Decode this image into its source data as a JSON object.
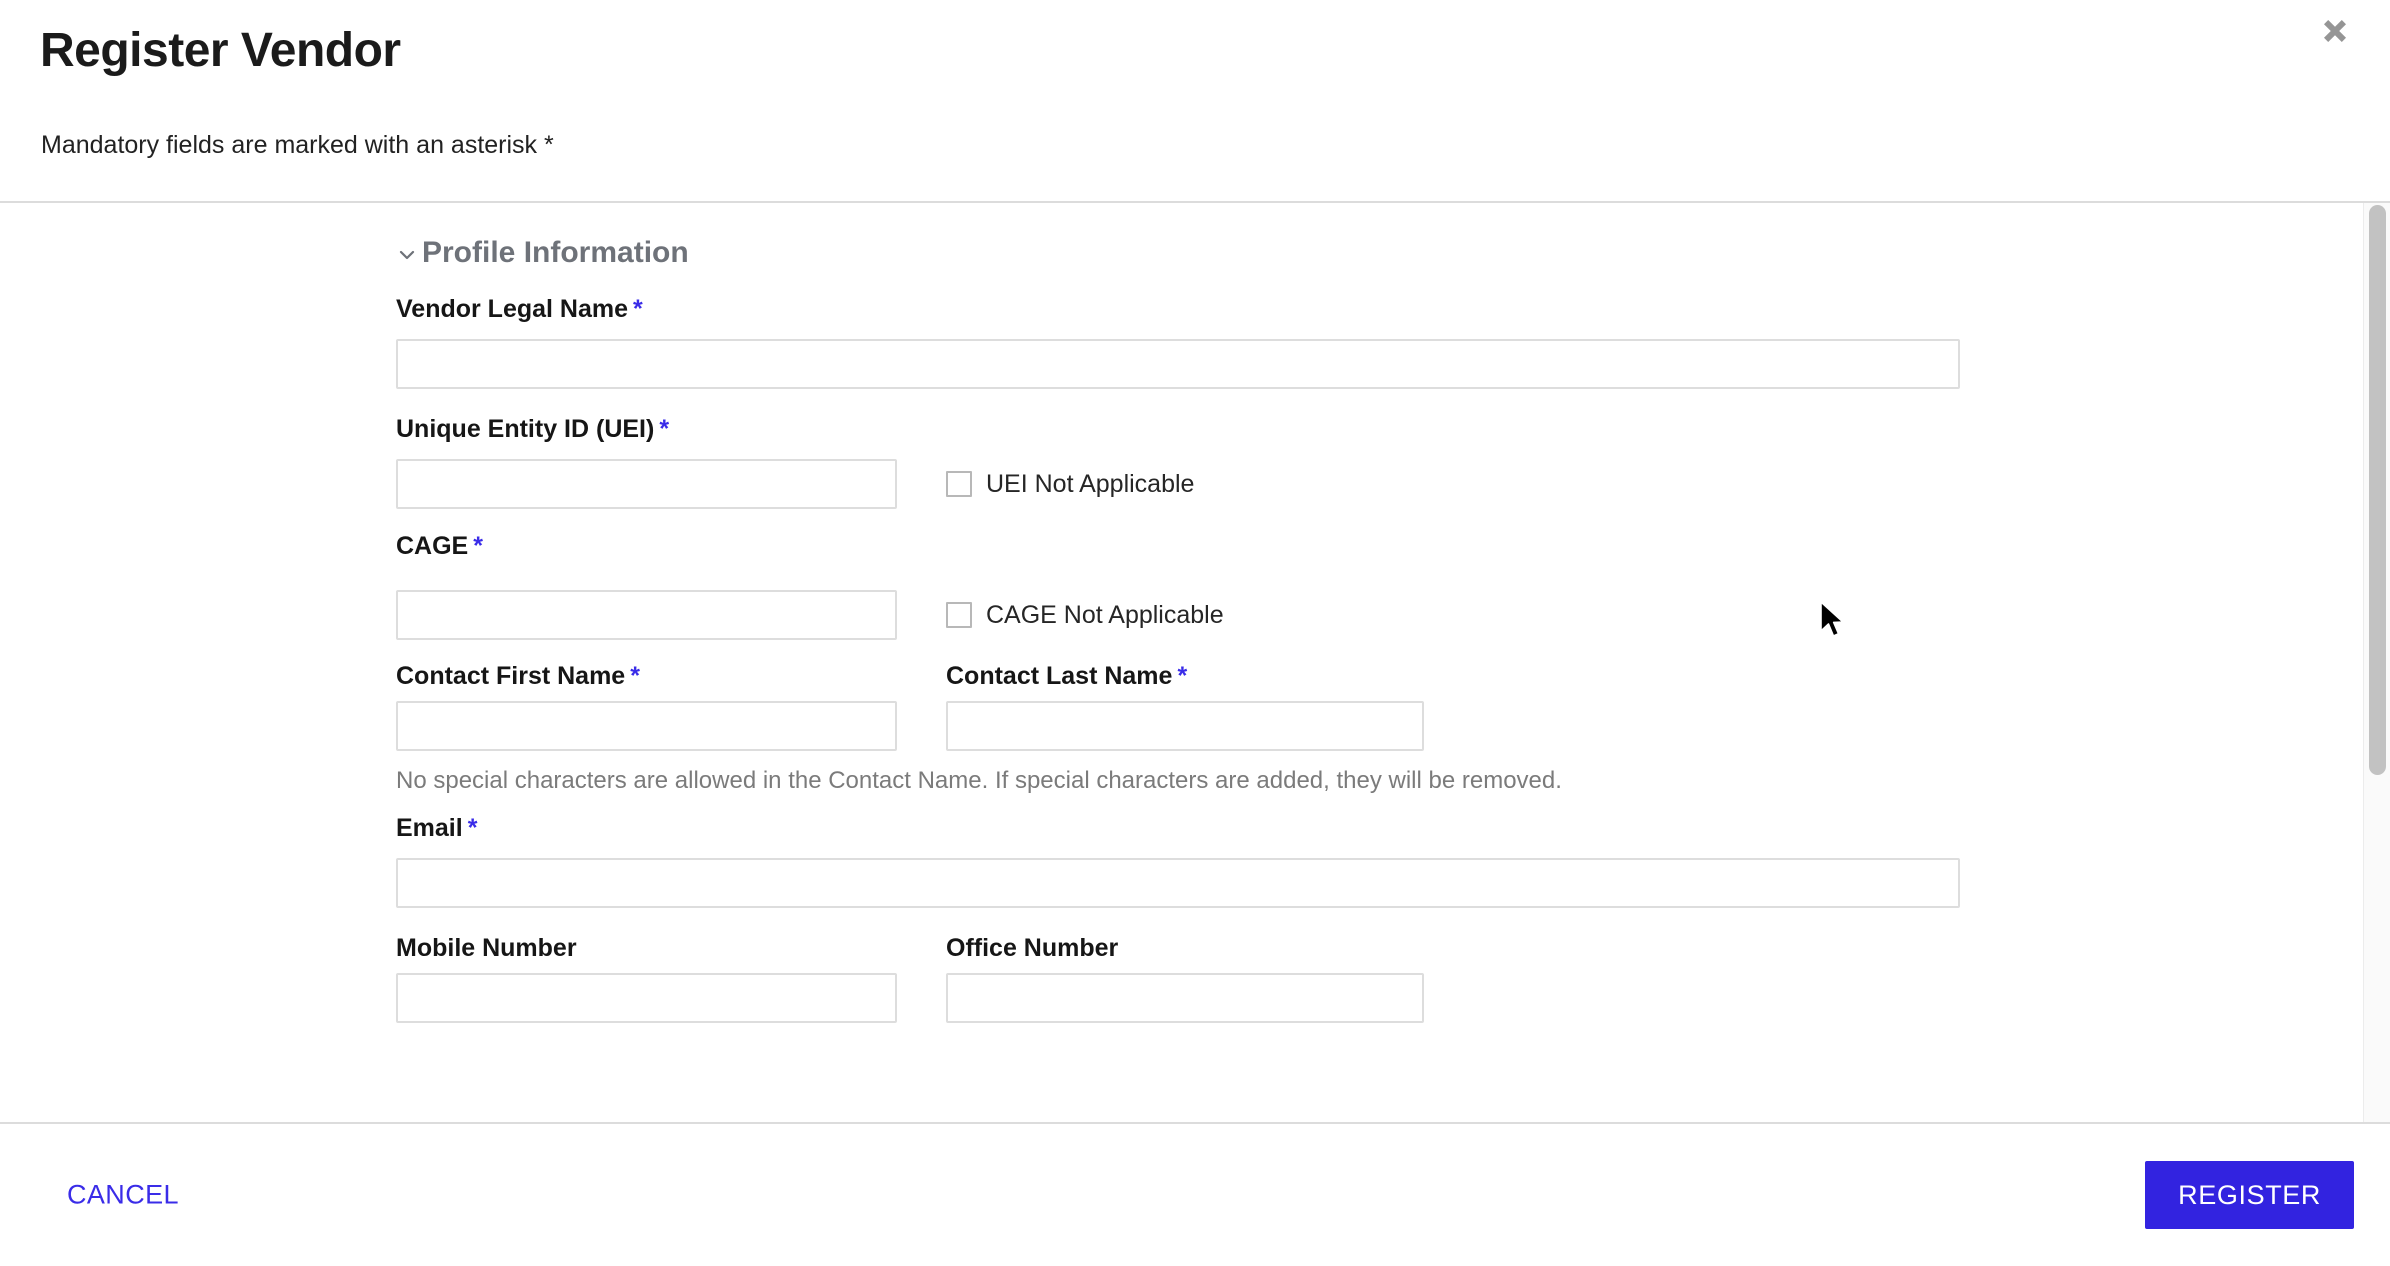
{
  "header": {
    "title": "Register Vendor",
    "subtitle": "Mandatory fields are marked with an asterisk *",
    "close_icon": "close-icon"
  },
  "section": {
    "title": "Profile Information",
    "chevron_icon": "chevron-down-icon",
    "expanded": true
  },
  "fields": {
    "vendor_legal_name": {
      "label": "Vendor Legal Name",
      "required_mark": "*",
      "value": "",
      "placeholder": ""
    },
    "uei": {
      "label": "Unique Entity ID (UEI)",
      "required_mark": "*",
      "value": "",
      "placeholder": "",
      "checkbox_label": "UEI Not Applicable",
      "checkbox_checked": false
    },
    "cage": {
      "label": "CAGE",
      "required_mark": "*",
      "value": "",
      "placeholder": "",
      "checkbox_label": "CAGE Not Applicable",
      "checkbox_checked": false
    },
    "contact_first_name": {
      "label": "Contact First Name",
      "required_mark": "*",
      "value": "",
      "placeholder": ""
    },
    "contact_last_name": {
      "label": "Contact Last Name",
      "required_mark": "*",
      "value": "",
      "placeholder": ""
    },
    "contact_name_helper": "No special characters are allowed in the Contact Name. If special characters are added, they will be removed.",
    "email": {
      "label": "Email",
      "required_mark": "*",
      "value": "",
      "placeholder": ""
    },
    "mobile_number": {
      "label": "Mobile Number",
      "value": "",
      "placeholder": ""
    },
    "office_number": {
      "label": "Office Number",
      "value": "",
      "placeholder": ""
    }
  },
  "footer": {
    "cancel_label": "CANCEL",
    "register_label": "REGISTER"
  },
  "colors": {
    "accent": "#3223e0",
    "required_asterisk": "#3a2ce8",
    "section_heading": "#6e7279",
    "input_border": "#dddddd",
    "divider": "#dcdcdc",
    "helper_text": "#7b7b7b",
    "scrollbar_thumb": "#c2c2c2"
  },
  "scrollbar": {
    "orientation": "vertical",
    "thumb_position": "top"
  }
}
